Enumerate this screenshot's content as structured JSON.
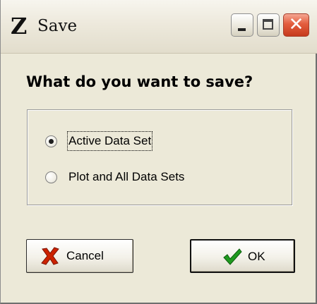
{
  "window": {
    "title": "Save",
    "app_icon_letter": "Z"
  },
  "dialog": {
    "question": "What do you want to save?",
    "options": [
      {
        "label": "Active Data Set",
        "selected": true
      },
      {
        "label": "Plot and All Data Sets",
        "selected": false
      }
    ],
    "buttons": {
      "cancel_label": "Cancel",
      "ok_label": "OK"
    }
  },
  "icons": {
    "cancel": "red-x-icon",
    "ok": "green-checkmark-icon",
    "minimize": "minimize-icon",
    "maximize": "maximize-icon",
    "close": "close-icon"
  },
  "colors": {
    "cancel_icon": "#cc2200",
    "ok_icon": "#1f9a1f",
    "close_button": "#e0593a",
    "dialog_background": "#ece9d8"
  }
}
